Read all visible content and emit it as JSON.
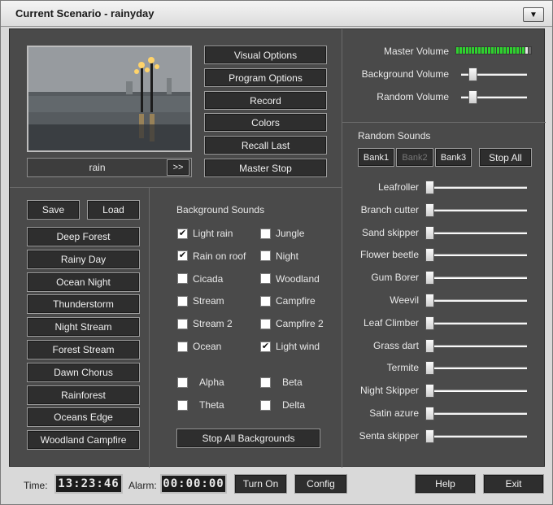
{
  "window": {
    "title": "Current Scenario - rainyday"
  },
  "preview": {
    "caption": "rain",
    "next_label": ">>"
  },
  "options": [
    "Visual Options",
    "Program Options",
    "Record",
    "Colors",
    "Recall Last",
    "Master Stop"
  ],
  "volume": {
    "master_label": "Master Volume",
    "background_label": "Background Volume",
    "random_label": "Random Volume",
    "background_level": 0.13,
    "random_level": 0.13,
    "meter_lit": 0.9,
    "meter_color_on": "#2fd12f",
    "meter_color_off": "#6a6a6a"
  },
  "random_sounds": {
    "heading": "Random Sounds",
    "banks": [
      {
        "label": "Bank1",
        "enabled": true
      },
      {
        "label": "Bank2",
        "enabled": false
      },
      {
        "label": "Bank3",
        "enabled": true
      }
    ],
    "stop_all_label": "Stop All",
    "items": [
      {
        "label": "Leafroller",
        "level": 0
      },
      {
        "label": "Branch cutter",
        "level": 0
      },
      {
        "label": "Sand skipper",
        "level": 0
      },
      {
        "label": "Flower beetle",
        "level": 0
      },
      {
        "label": "Gum Borer",
        "level": 0
      },
      {
        "label": "Weevil",
        "level": 0
      },
      {
        "label": "Leaf Climber",
        "level": 0
      },
      {
        "label": "Grass dart",
        "level": 0
      },
      {
        "label": "Termite",
        "level": 0
      },
      {
        "label": "Night Skipper",
        "level": 0
      },
      {
        "label": "Satin azure",
        "level": 0
      },
      {
        "label": "Senta skipper",
        "level": 0
      }
    ]
  },
  "scenarios": {
    "save_label": "Save",
    "load_label": "Load",
    "items": [
      "Deep Forest",
      "Rainy Day",
      "Ocean Night",
      "Thunderstorm",
      "Night Stream",
      "Forest Stream",
      "Dawn Chorus",
      "Rainforest",
      "Oceans Edge",
      "Woodland Campfire"
    ]
  },
  "background_sounds": {
    "heading": "Background Sounds",
    "left": [
      {
        "label": "Light rain",
        "checked": true
      },
      {
        "label": "Rain on roof",
        "checked": true
      },
      {
        "label": "Cicada",
        "checked": false
      },
      {
        "label": "Stream",
        "checked": false
      },
      {
        "label": "Stream 2",
        "checked": false
      },
      {
        "label": "Ocean",
        "checked": false
      }
    ],
    "right": [
      {
        "label": "Jungle",
        "checked": false
      },
      {
        "label": "Night",
        "checked": false
      },
      {
        "label": "Woodland",
        "checked": false
      },
      {
        "label": "Campfire",
        "checked": false
      },
      {
        "label": "Campfire 2",
        "checked": false
      },
      {
        "label": "Light wind",
        "checked": true
      }
    ],
    "waves_left": [
      {
        "label": "Alpha",
        "checked": false
      },
      {
        "label": "Theta",
        "checked": false
      }
    ],
    "waves_right": [
      {
        "label": "Beta",
        "checked": false
      },
      {
        "label": "Delta",
        "checked": false
      }
    ],
    "stop_all_label": "Stop All Backgrounds"
  },
  "footer": {
    "time_label": "Time:",
    "time_value": "13:23:46",
    "alarm_label": "Alarm:",
    "alarm_value": "00:00:00",
    "turn_on_label": "Turn On",
    "config_label": "Config",
    "help_label": "Help",
    "exit_label": "Exit"
  }
}
